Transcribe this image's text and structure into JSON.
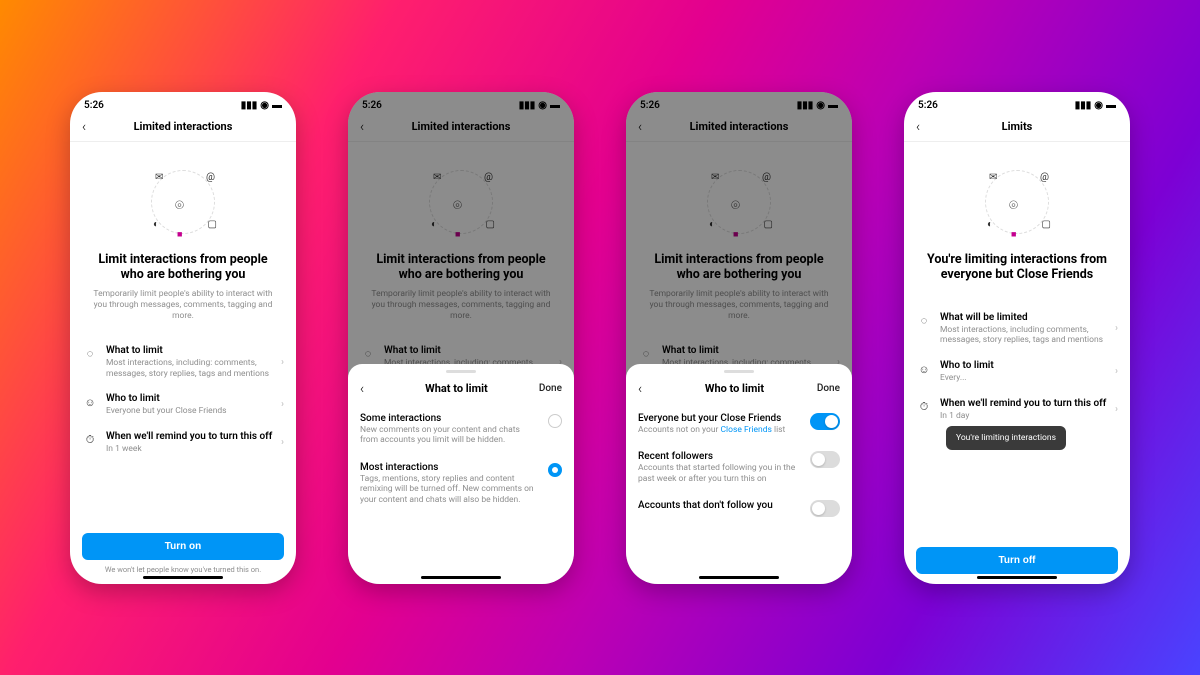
{
  "status": {
    "time": "5:26"
  },
  "phone1": {
    "header": "Limited interactions",
    "hero_title": "Limit interactions from people who are bothering you",
    "hero_sub": "Temporarily limit people's ability to interact with you through messages, comments, tagging and more.",
    "rows": [
      {
        "title": "What to limit",
        "sub": "Most interactions, including: comments, messages, story replies, tags and mentions"
      },
      {
        "title": "Who to limit",
        "sub": "Everyone but your Close Friends"
      },
      {
        "title": "When we'll remind you to turn this off",
        "sub": "In 1 week"
      }
    ],
    "button": "Turn on",
    "note": "We won't let people know you've turned this on."
  },
  "sheet_what": {
    "title": "What to limit",
    "done": "Done",
    "opts": [
      {
        "title": "Some interactions",
        "sub": "New comments on your content and chats from accounts you limit will be hidden.",
        "selected": false
      },
      {
        "title": "Most interactions",
        "sub": "Tags, mentions, story replies and content remixing will be turned off. New comments on your content and chats will also be hidden.",
        "selected": true
      }
    ]
  },
  "sheet_who": {
    "title": "Who to limit",
    "done": "Done",
    "opts": [
      {
        "title": "Everyone but your Close Friends",
        "sub_pre": "Accounts not on your ",
        "sub_link": "Close Friends",
        "sub_post": " list",
        "on": true
      },
      {
        "title": "Recent followers",
        "sub": "Accounts that started following you in the past week or after you turn this on",
        "on": false
      },
      {
        "title": "Accounts that don't follow you",
        "sub": "",
        "on": false
      }
    ]
  },
  "phone4": {
    "header": "Limits",
    "hero_title": "You're limiting interactions from everyone but Close Friends",
    "rows": [
      {
        "title": "What will be limited",
        "sub": "Most interactions, including comments, messages, story replies, tags and mentions"
      },
      {
        "title": "Who to limit",
        "sub": "Every..."
      },
      {
        "title": "When we'll remind you to turn this off",
        "sub": "In 1 day"
      }
    ],
    "toast": "You're limiting interactions",
    "button": "Turn off"
  }
}
